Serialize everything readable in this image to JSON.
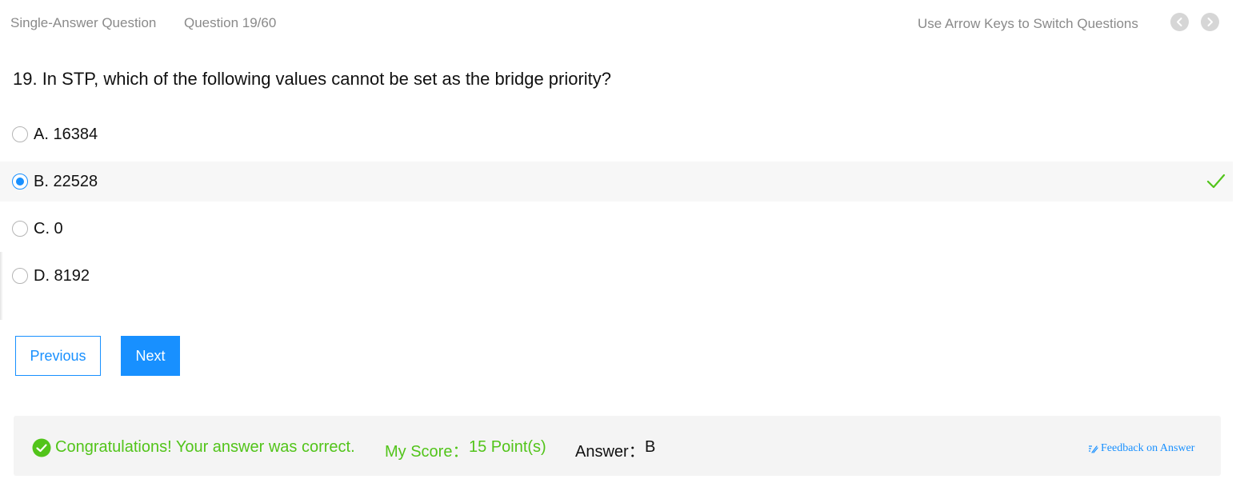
{
  "header": {
    "question_type": "Single-Answer Question",
    "question_count": "Question 19/60",
    "hint": "Use Arrow Keys to Switch Questions"
  },
  "question": {
    "text": "19. In STP, which of the following values cannot be set as the bridge priority?",
    "options": [
      {
        "label": "A. 16384",
        "selected": false
      },
      {
        "label": "B. 22528",
        "selected": true,
        "correct": true
      },
      {
        "label": "C. 0",
        "selected": false
      },
      {
        "label": "D. 8192",
        "selected": false
      }
    ]
  },
  "buttons": {
    "previous": "Previous",
    "next": "Next"
  },
  "result": {
    "message": "Congratulations! Your answer was correct.",
    "score_label": "My Score：",
    "score_value": "15 Point(s)",
    "answer_label": "Answer：",
    "answer_value": "B",
    "feedback": "Feedback on Answer"
  },
  "icons": {
    "nav_prev": "chevron-left-icon",
    "nav_next": "chevron-right-icon",
    "correct_check": "check-icon",
    "success": "check-circle-icon",
    "feedback": "feedback-edit-icon"
  },
  "colors": {
    "accent": "#1890ff",
    "success": "#52c41a",
    "muted_text": "#8a8a8a",
    "selected_row": "#f7f7f7",
    "result_bg": "#f4f4f4"
  }
}
